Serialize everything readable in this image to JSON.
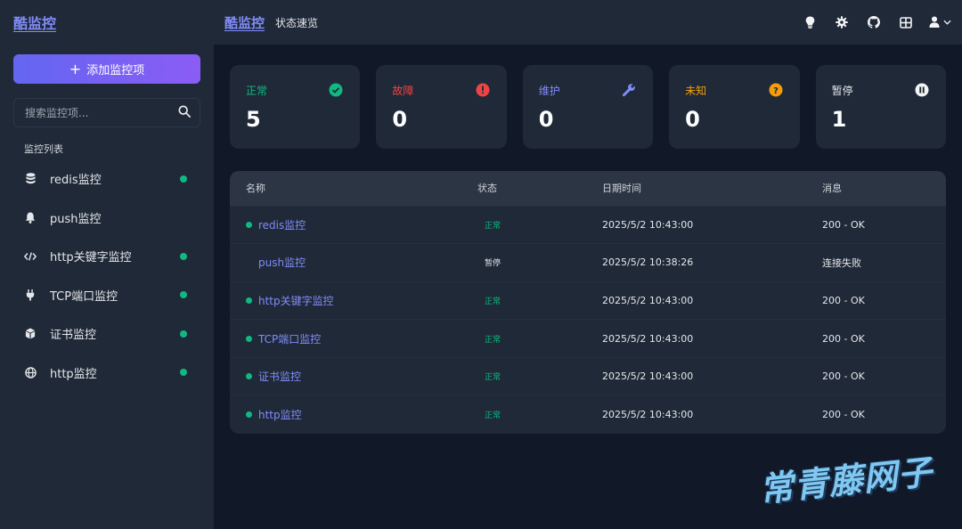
{
  "app": {
    "brand": "酷监控",
    "page_subtitle": "状态速览"
  },
  "sidebar": {
    "add_button_label": "添加监控项",
    "search_placeholder": "搜索监控项...",
    "section_label": "监控列表",
    "items": [
      {
        "label": "redis监控",
        "icon": "database-icon",
        "active": true
      },
      {
        "label": "push监控",
        "icon": "bell-icon",
        "active": false
      },
      {
        "label": "http关键字监控",
        "icon": "code-icon",
        "active": true
      },
      {
        "label": "TCP端口监控",
        "icon": "plug-icon",
        "active": true
      },
      {
        "label": "证书监控",
        "icon": "cube-icon",
        "active": true
      },
      {
        "label": "http监控",
        "icon": "globe-icon",
        "active": true
      }
    ]
  },
  "topbar_icons": [
    "lightbulb-icon",
    "gear-icon",
    "github-icon",
    "grid-icon",
    "user-icon",
    "chevron-down-icon"
  ],
  "summary_cards": [
    {
      "label": "正常",
      "count": "5",
      "color": "#10b981",
      "icon": "check-circle-icon"
    },
    {
      "label": "故障",
      "count": "0",
      "color": "#ef4444",
      "icon": "exclamation-circle-icon"
    },
    {
      "label": "维护",
      "count": "0",
      "color": "#818cf8",
      "icon": "wrench-icon"
    },
    {
      "label": "未知",
      "count": "0",
      "color": "#f59e0b",
      "icon": "question-circle-icon"
    },
    {
      "label": "暂停",
      "count": "1",
      "color": "#e5e7eb",
      "icon": "pause-circle-icon"
    }
  ],
  "table": {
    "headers": [
      "名称",
      "状态",
      "日期时间",
      "消息"
    ],
    "rows": [
      {
        "name": "redis监控",
        "status": "正常",
        "datetime": "2025/5/2 10:43:00",
        "message": "200 - OK",
        "active": true
      },
      {
        "name": "push监控",
        "status": "暂停",
        "datetime": "2025/5/2 10:38:26",
        "message": "连接失败",
        "active": false
      },
      {
        "name": "http关键字监控",
        "status": "正常",
        "datetime": "2025/5/2 10:43:00",
        "message": "200 - OK",
        "active": true
      },
      {
        "name": "TCP端口监控",
        "status": "正常",
        "datetime": "2025/5/2 10:43:00",
        "message": "200 - OK",
        "active": true
      },
      {
        "name": "证书监控",
        "status": "正常",
        "datetime": "2025/5/2 10:43:00",
        "message": "200 - OK",
        "active": true
      },
      {
        "name": "http监控",
        "status": "正常",
        "datetime": "2025/5/2 10:43:00",
        "message": "200 - OK",
        "active": true
      }
    ]
  },
  "watermark": "常青藤网子"
}
